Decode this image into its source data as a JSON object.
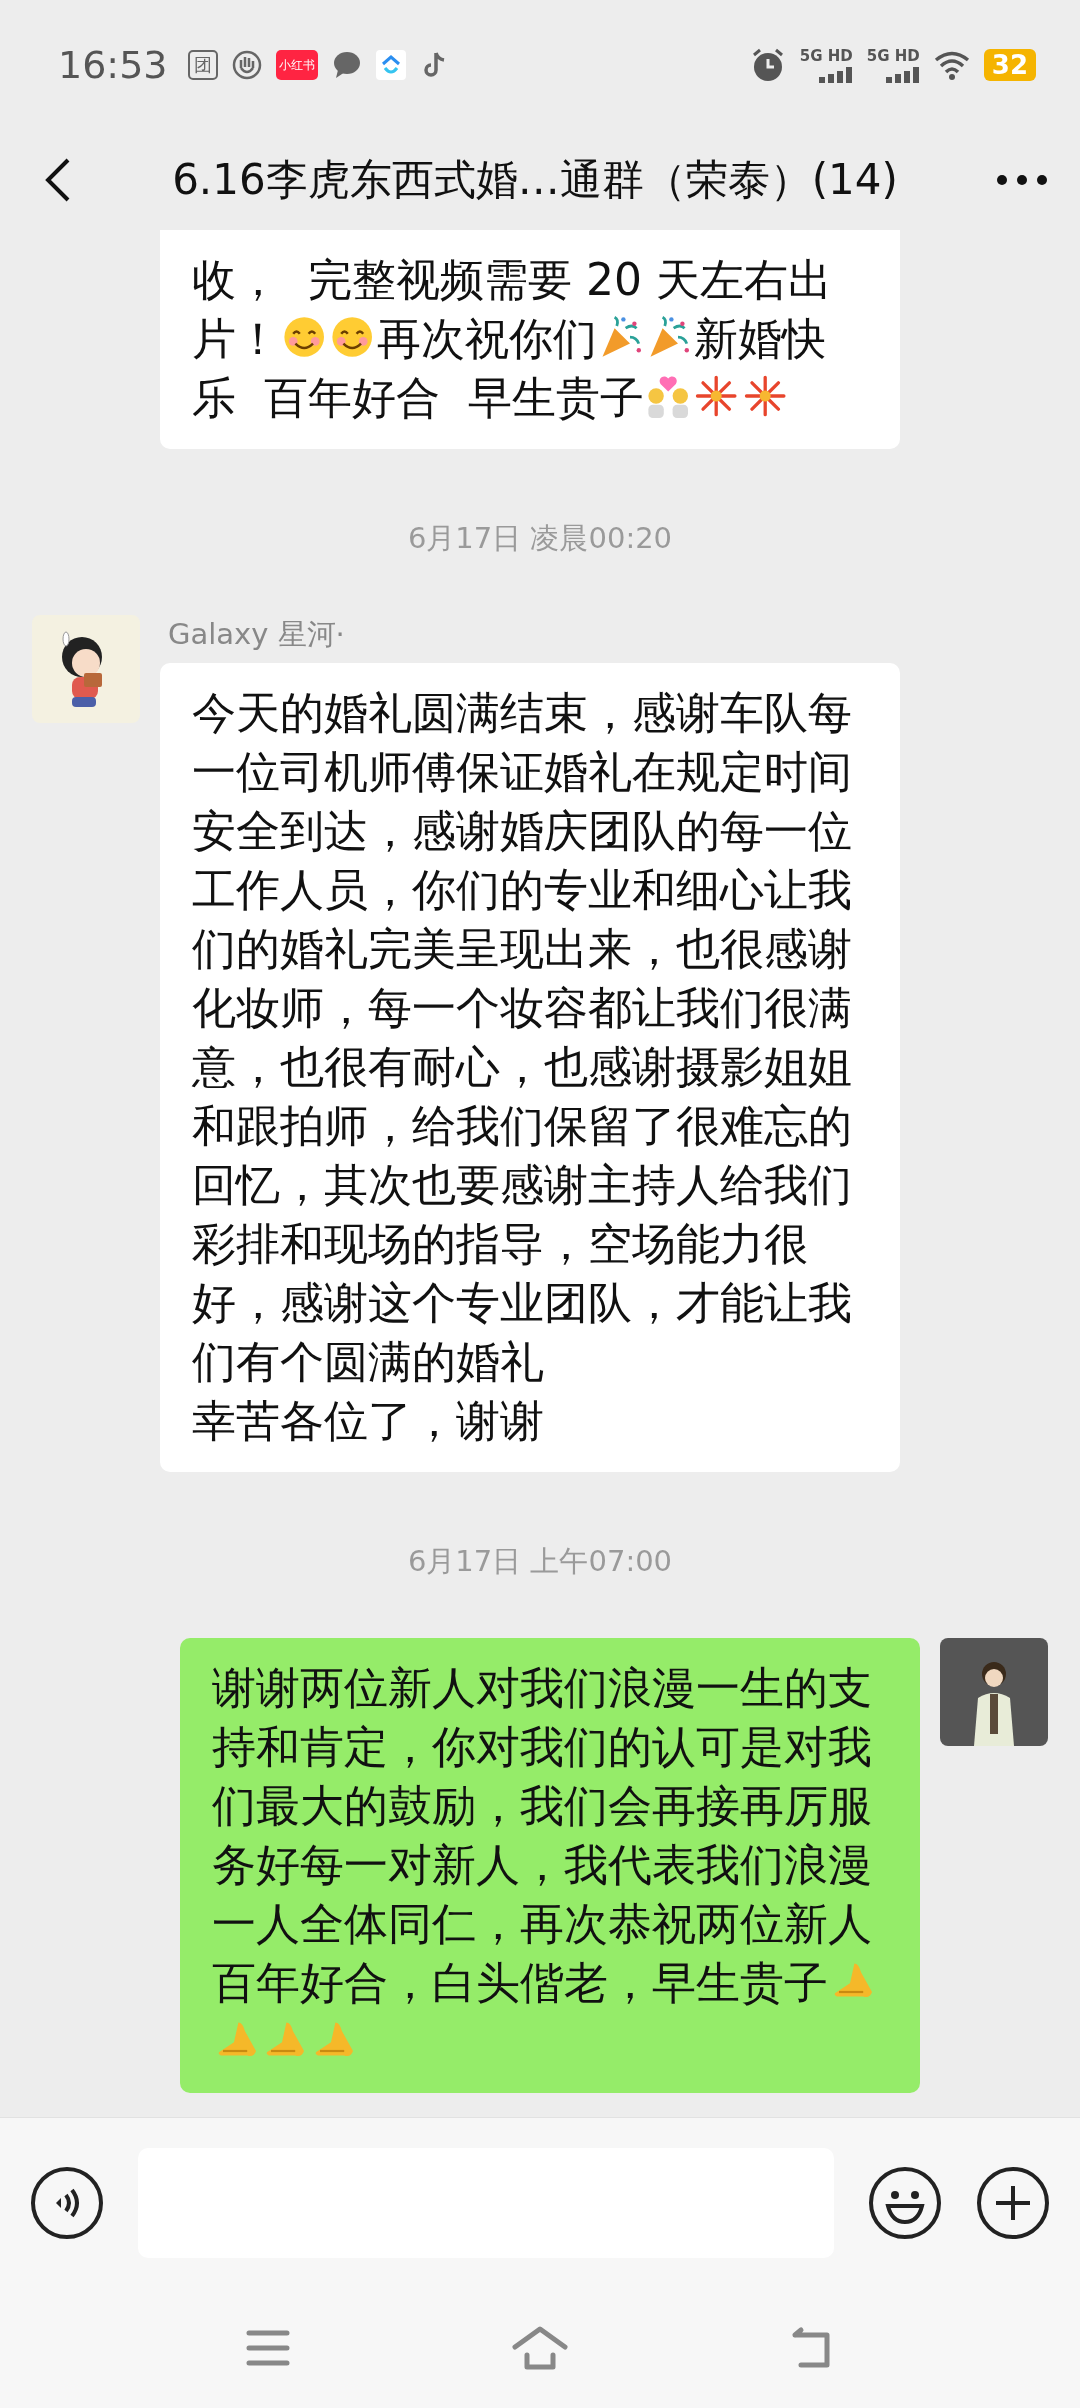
{
  "status_bar": {
    "time": "16:53",
    "notification_icons": [
      {
        "kind": "tuan",
        "label": "团"
      },
      {
        "kind": "hand"
      },
      {
        "kind": "red_app",
        "label": "小红书"
      },
      {
        "kind": "chat"
      },
      {
        "kind": "cloud"
      },
      {
        "kind": "note"
      }
    ],
    "network": [
      {
        "label": "5G HD"
      },
      {
        "label": "5G HD"
      }
    ],
    "battery": "32"
  },
  "header": {
    "title": "6.16李虎东西式婚…通群（荣泰）(14)"
  },
  "chat": [
    {
      "kind": "incoming",
      "paragraphs": [
        [
          {
            "kind": "text",
            "text": "收，  完整视频需要 20 天左右出片！"
          },
          {
            "kind": "smile"
          },
          {
            "kind": "smile"
          },
          {
            "kind": "text",
            "text": "再次祝你们"
          },
          {
            "kind": "party"
          },
          {
            "kind": "party"
          },
          {
            "kind": "text",
            "text": "新婚快乐  百年好合  早生贵子"
          },
          {
            "kind": "couple"
          },
          {
            "kind": "fireworks"
          },
          {
            "kind": "fireworks"
          }
        ]
      ]
    },
    {
      "kind": "time",
      "text": "6月17日 凌晨00:20"
    },
    {
      "kind": "incoming",
      "avatar": {
        "kind": "picture"
      },
      "sender": "Galaxy 星河·",
      "paragraphs": [
        [
          {
            "kind": "text",
            "text": "今天的婚礼圆满结束，感谢车队每一位司机师傅保证婚礼在规定时间安全到达，感谢婚庆团队的每一位工作人员，你们的专业和细心让我们的婚礼完美呈现出来，也很感谢化妆师，每一个妆容都让我们很满意，也很有耐心，也感谢摄影姐姐和跟拍师，给我们保留了很难忘的回忆，其次也要感谢主持人给我们彩排和现场的指导，空场能力很好，感谢这个专业团队，才能让我们有个圆满的婚礼"
          }
        ],
        [
          {
            "kind": "text",
            "text": "幸苦各位了，谢谢"
          }
        ]
      ]
    },
    {
      "kind": "time",
      "text": "6月17日 上午07:00"
    },
    {
      "kind": "outgoing",
      "avatar": {
        "kind": "picture"
      },
      "paragraphs": [
        [
          {
            "kind": "text",
            "text": "谢谢两位新人对我们浪漫一生的支持和肯定，你对我们的认可是对我们最大的鼓励，我们会再接再厉服务好每一对新人，我代表我们浪漫一人全体同仁，再次恭祝两位新人百年好合，白头偕老，早生贵子"
          },
          {
            "kind": "pray"
          },
          {
            "kind": "pray"
          },
          {
            "kind": "pray"
          },
          {
            "kind": "pray"
          }
        ]
      ]
    }
  ]
}
